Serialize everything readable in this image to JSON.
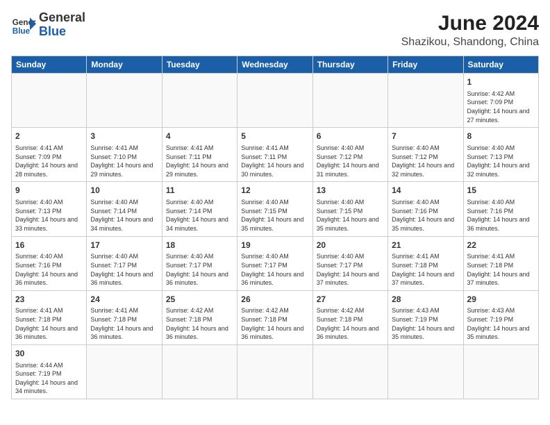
{
  "header": {
    "logo_general": "General",
    "logo_blue": "Blue",
    "title": "June 2024",
    "subtitle": "Shazikou, Shandong, China"
  },
  "weekdays": [
    "Sunday",
    "Monday",
    "Tuesday",
    "Wednesday",
    "Thursday",
    "Friday",
    "Saturday"
  ],
  "weeks": [
    [
      {
        "day": "",
        "info": ""
      },
      {
        "day": "",
        "info": ""
      },
      {
        "day": "",
        "info": ""
      },
      {
        "day": "",
        "info": ""
      },
      {
        "day": "",
        "info": ""
      },
      {
        "day": "",
        "info": ""
      },
      {
        "day": "1",
        "info": "Sunrise: 4:42 AM\nSunset: 7:09 PM\nDaylight: 14 hours\nand 27 minutes."
      }
    ],
    [
      {
        "day": "2",
        "info": "Sunrise: 4:41 AM\nSunset: 7:09 PM\nDaylight: 14 hours\nand 28 minutes."
      },
      {
        "day": "3",
        "info": "Sunrise: 4:41 AM\nSunset: 7:10 PM\nDaylight: 14 hours\nand 29 minutes."
      },
      {
        "day": "4",
        "info": "Sunrise: 4:41 AM\nSunset: 7:11 PM\nDaylight: 14 hours\nand 29 minutes."
      },
      {
        "day": "5",
        "info": "Sunrise: 4:41 AM\nSunset: 7:11 PM\nDaylight: 14 hours\nand 30 minutes."
      },
      {
        "day": "6",
        "info": "Sunrise: 4:40 AM\nSunset: 7:12 PM\nDaylight: 14 hours\nand 31 minutes."
      },
      {
        "day": "7",
        "info": "Sunrise: 4:40 AM\nSunset: 7:12 PM\nDaylight: 14 hours\nand 32 minutes."
      },
      {
        "day": "8",
        "info": "Sunrise: 4:40 AM\nSunset: 7:13 PM\nDaylight: 14 hours\nand 32 minutes."
      }
    ],
    [
      {
        "day": "9",
        "info": "Sunrise: 4:40 AM\nSunset: 7:13 PM\nDaylight: 14 hours\nand 33 minutes."
      },
      {
        "day": "10",
        "info": "Sunrise: 4:40 AM\nSunset: 7:14 PM\nDaylight: 14 hours\nand 34 minutes."
      },
      {
        "day": "11",
        "info": "Sunrise: 4:40 AM\nSunset: 7:14 PM\nDaylight: 14 hours\nand 34 minutes."
      },
      {
        "day": "12",
        "info": "Sunrise: 4:40 AM\nSunset: 7:15 PM\nDaylight: 14 hours\nand 35 minutes."
      },
      {
        "day": "13",
        "info": "Sunrise: 4:40 AM\nSunset: 7:15 PM\nDaylight: 14 hours\nand 35 minutes."
      },
      {
        "day": "14",
        "info": "Sunrise: 4:40 AM\nSunset: 7:16 PM\nDaylight: 14 hours\nand 35 minutes."
      },
      {
        "day": "15",
        "info": "Sunrise: 4:40 AM\nSunset: 7:16 PM\nDaylight: 14 hours\nand 36 minutes."
      }
    ],
    [
      {
        "day": "16",
        "info": "Sunrise: 4:40 AM\nSunset: 7:16 PM\nDaylight: 14 hours\nand 36 minutes."
      },
      {
        "day": "17",
        "info": "Sunrise: 4:40 AM\nSunset: 7:17 PM\nDaylight: 14 hours\nand 36 minutes."
      },
      {
        "day": "18",
        "info": "Sunrise: 4:40 AM\nSunset: 7:17 PM\nDaylight: 14 hours\nand 36 minutes."
      },
      {
        "day": "19",
        "info": "Sunrise: 4:40 AM\nSunset: 7:17 PM\nDaylight: 14 hours\nand 36 minutes."
      },
      {
        "day": "20",
        "info": "Sunrise: 4:40 AM\nSunset: 7:17 PM\nDaylight: 14 hours\nand 37 minutes."
      },
      {
        "day": "21",
        "info": "Sunrise: 4:41 AM\nSunset: 7:18 PM\nDaylight: 14 hours\nand 37 minutes."
      },
      {
        "day": "22",
        "info": "Sunrise: 4:41 AM\nSunset: 7:18 PM\nDaylight: 14 hours\nand 37 minutes."
      }
    ],
    [
      {
        "day": "23",
        "info": "Sunrise: 4:41 AM\nSunset: 7:18 PM\nDaylight: 14 hours\nand 36 minutes."
      },
      {
        "day": "24",
        "info": "Sunrise: 4:41 AM\nSunset: 7:18 PM\nDaylight: 14 hours\nand 36 minutes."
      },
      {
        "day": "25",
        "info": "Sunrise: 4:42 AM\nSunset: 7:18 PM\nDaylight: 14 hours\nand 36 minutes."
      },
      {
        "day": "26",
        "info": "Sunrise: 4:42 AM\nSunset: 7:18 PM\nDaylight: 14 hours\nand 36 minutes."
      },
      {
        "day": "27",
        "info": "Sunrise: 4:42 AM\nSunset: 7:18 PM\nDaylight: 14 hours\nand 36 minutes."
      },
      {
        "day": "28",
        "info": "Sunrise: 4:43 AM\nSunset: 7:19 PM\nDaylight: 14 hours\nand 35 minutes."
      },
      {
        "day": "29",
        "info": "Sunrise: 4:43 AM\nSunset: 7:19 PM\nDaylight: 14 hours\nand 35 minutes."
      }
    ],
    [
      {
        "day": "30",
        "info": "Sunrise: 4:44 AM\nSunset: 7:19 PM\nDaylight: 14 hours\nand 34 minutes."
      },
      {
        "day": "",
        "info": ""
      },
      {
        "day": "",
        "info": ""
      },
      {
        "day": "",
        "info": ""
      },
      {
        "day": "",
        "info": ""
      },
      {
        "day": "",
        "info": ""
      },
      {
        "day": "",
        "info": ""
      }
    ]
  ]
}
